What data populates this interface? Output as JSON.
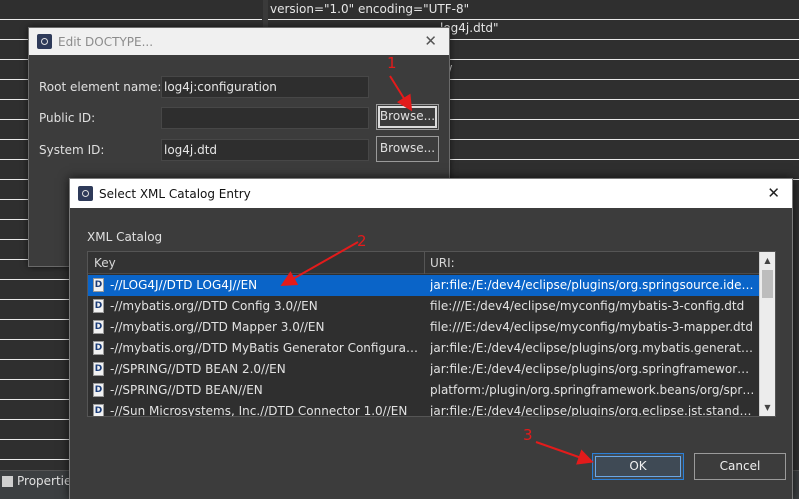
{
  "background": {
    "code_line_1": "version=\"1.0\" encoding=\"UTF-8\"",
    "code_line_2": "log4j.dtd\"",
    "code_line_3": "/",
    "bottom_tab_label": "Properties"
  },
  "edit_dialog": {
    "title": "Edit DOCTYPE...",
    "close_glyph": "✕",
    "fields": [
      {
        "label": "Root element name:",
        "value": "log4j:configuration"
      },
      {
        "label": "Public ID:",
        "value": ""
      },
      {
        "label": "System ID:",
        "value": "log4j.dtd"
      }
    ],
    "browse_label": "Browse..."
  },
  "select_dialog": {
    "title": "Select XML Catalog Entry",
    "close_glyph": "✕",
    "section_label": "XML Catalog",
    "columns": {
      "key": "Key",
      "uri": "URI:"
    },
    "rows": [
      {
        "key": "-//LOG4J//DTD LOG4J//EN",
        "uri": "jar:file:/E:/dev4/eclipse/plugins/org.springsource.ide.e...",
        "selected": true
      },
      {
        "key": "-//mybatis.org//DTD Config 3.0//EN",
        "uri": "file:///E:/dev4/eclipse/myconfig/mybatis-3-config.dtd",
        "selected": false
      },
      {
        "key": "-//mybatis.org//DTD Mapper 3.0//EN",
        "uri": "file:///E:/dev4/eclipse/myconfig/mybatis-3-mapper.dtd",
        "selected": false
      },
      {
        "key": "-//mybatis.org//DTD MyBatis Generator Configurati...",
        "uri": "jar:file:/E:/dev4/eclipse/plugins/org.mybatis.generator...",
        "selected": false
      },
      {
        "key": "-//SPRING//DTD BEAN 2.0//EN",
        "uri": "jar:file:/E:/dev4/eclipse/plugins/org.springframework....",
        "selected": false
      },
      {
        "key": "-//SPRING//DTD BEAN//EN",
        "uri": "platform:/plugin/org.springframework.beans/org/spri...",
        "selected": false
      },
      {
        "key": "-//Sun Microsystems, Inc.//DTD Connector 1.0//EN",
        "uri": "jar:file:/E:/dev4/eclipse/plugins/org.eclipse.jst.standar...",
        "selected": false
      }
    ],
    "doc_icon_glyph": "D",
    "ok_label": "OK",
    "cancel_label": "Cancel"
  },
  "annotations": {
    "step_1": "1",
    "step_2": "2",
    "step_3": "3",
    "color": "#e31b1b"
  },
  "colors": {
    "selection": "#0a64c8",
    "dialog_bg": "#3c3c3c",
    "ok_border": "#2b7fd6"
  }
}
